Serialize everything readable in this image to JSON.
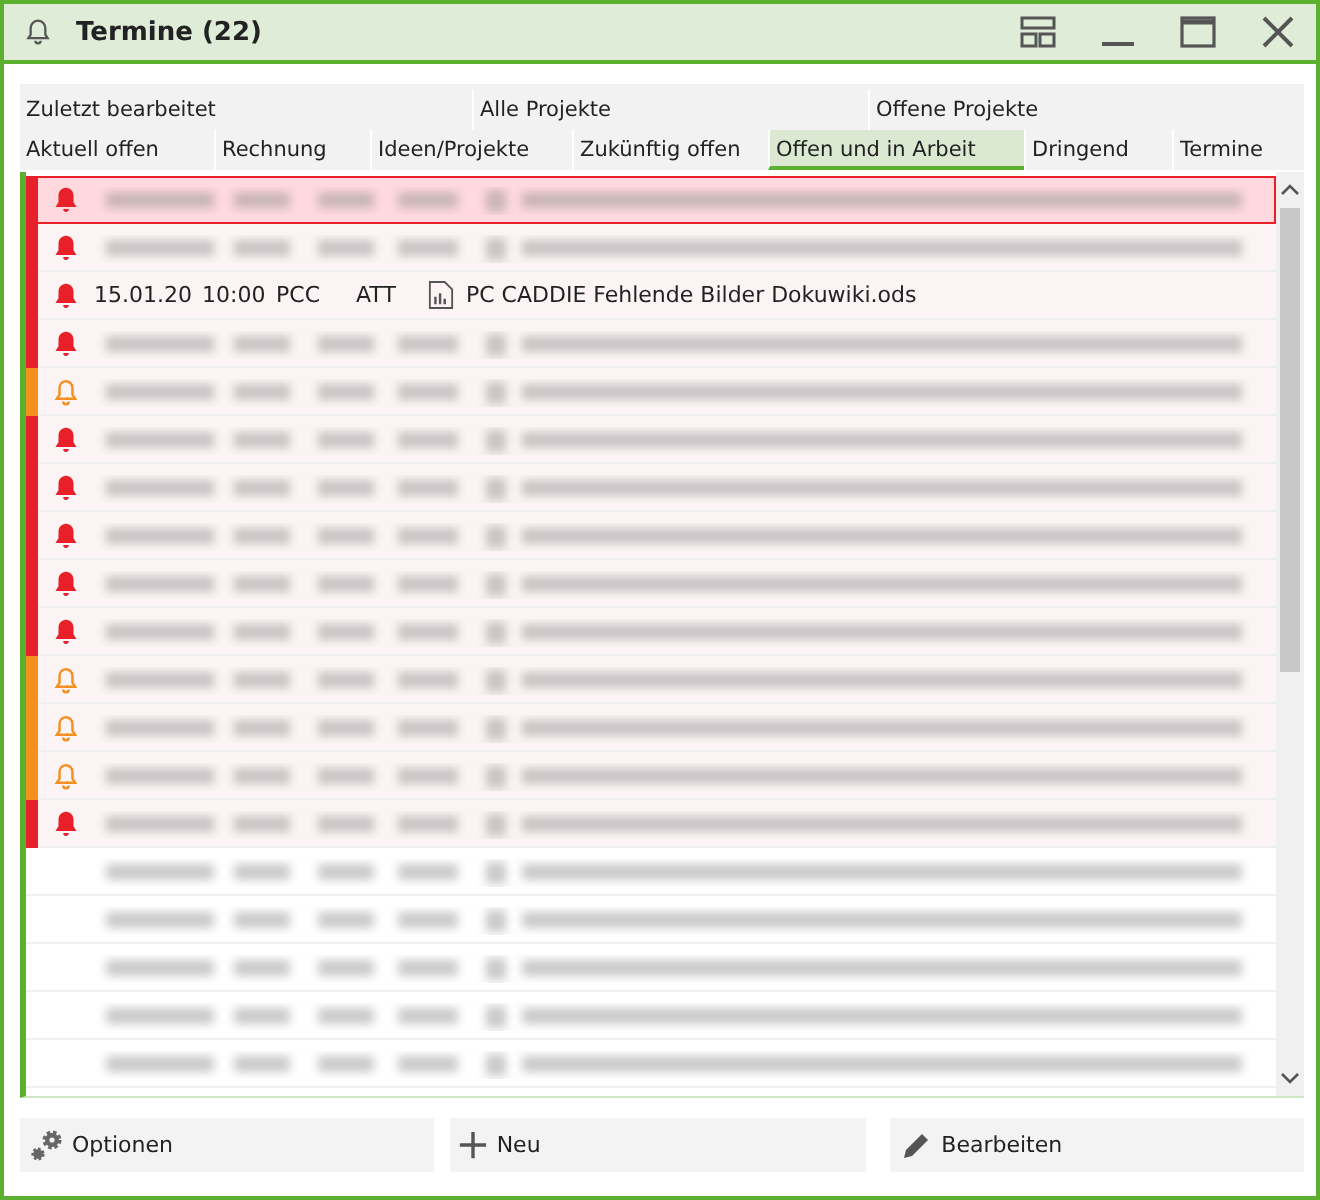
{
  "window": {
    "title": "Termine (22)"
  },
  "tab_rows": [
    [
      {
        "label": "Zuletzt bearbeitet",
        "selected": false
      },
      {
        "label": "Alle Projekte",
        "selected": false
      },
      {
        "label": "Offene Projekte",
        "selected": false
      }
    ],
    [
      {
        "label": "Aktuell offen",
        "selected": false
      },
      {
        "label": "Rechnung",
        "selected": false
      },
      {
        "label": "Ideen/Projekte",
        "selected": false
      },
      {
        "label": "Zukünftig offen",
        "selected": false
      },
      {
        "label": "Offen und in Arbeit",
        "selected": true
      },
      {
        "label": "Dringend",
        "selected": false
      },
      {
        "label": "Termine",
        "selected": false
      }
    ]
  ],
  "rows": [
    {
      "kind": "blurred",
      "color": "#e8202a",
      "urgent": true,
      "selected": true
    },
    {
      "kind": "blurred",
      "color": "#e8202a",
      "urgent": true,
      "selected": false
    },
    {
      "kind": "entry",
      "color": "#e8202a",
      "urgent": true,
      "selected": false,
      "date": "15.01.20",
      "time": "10:00",
      "project": "PCC",
      "user": "ATT",
      "title": "PC CADDIE Fehlende Bilder Dokuwiki.ods"
    },
    {
      "kind": "blurred",
      "color": "#e8202a",
      "urgent": true,
      "selected": false
    },
    {
      "kind": "blurred",
      "color": "#f5901e",
      "urgent": false,
      "selected": false
    },
    {
      "kind": "blurred",
      "color": "#e8202a",
      "urgent": true,
      "selected": false
    },
    {
      "kind": "blurred",
      "color": "#e8202a",
      "urgent": true,
      "selected": false
    },
    {
      "kind": "blurred",
      "color": "#e8202a",
      "urgent": true,
      "selected": false
    },
    {
      "kind": "blurred",
      "color": "#e8202a",
      "urgent": true,
      "selected": false
    },
    {
      "kind": "blurred",
      "color": "#e8202a",
      "urgent": true,
      "selected": false
    },
    {
      "kind": "blurred",
      "color": "#f5901e",
      "urgent": false,
      "selected": false
    },
    {
      "kind": "blurred",
      "color": "#f5901e",
      "urgent": false,
      "selected": false
    },
    {
      "kind": "blurred",
      "color": "#f5901e",
      "urgent": false,
      "selected": false
    },
    {
      "kind": "blurred",
      "color": "#e8202a",
      "urgent": true,
      "selected": false
    },
    {
      "kind": "blurred",
      "selected": false
    },
    {
      "kind": "blurred",
      "selected": false
    },
    {
      "kind": "blurred",
      "selected": false
    },
    {
      "kind": "blurred",
      "selected": false
    },
    {
      "kind": "blurred",
      "selected": false
    }
  ],
  "buttons": [
    {
      "kind": "options",
      "label": "Optionen"
    },
    {
      "kind": "new",
      "label": "Neu"
    },
    {
      "kind": "edit",
      "label": "Bearbeiten"
    }
  ]
}
